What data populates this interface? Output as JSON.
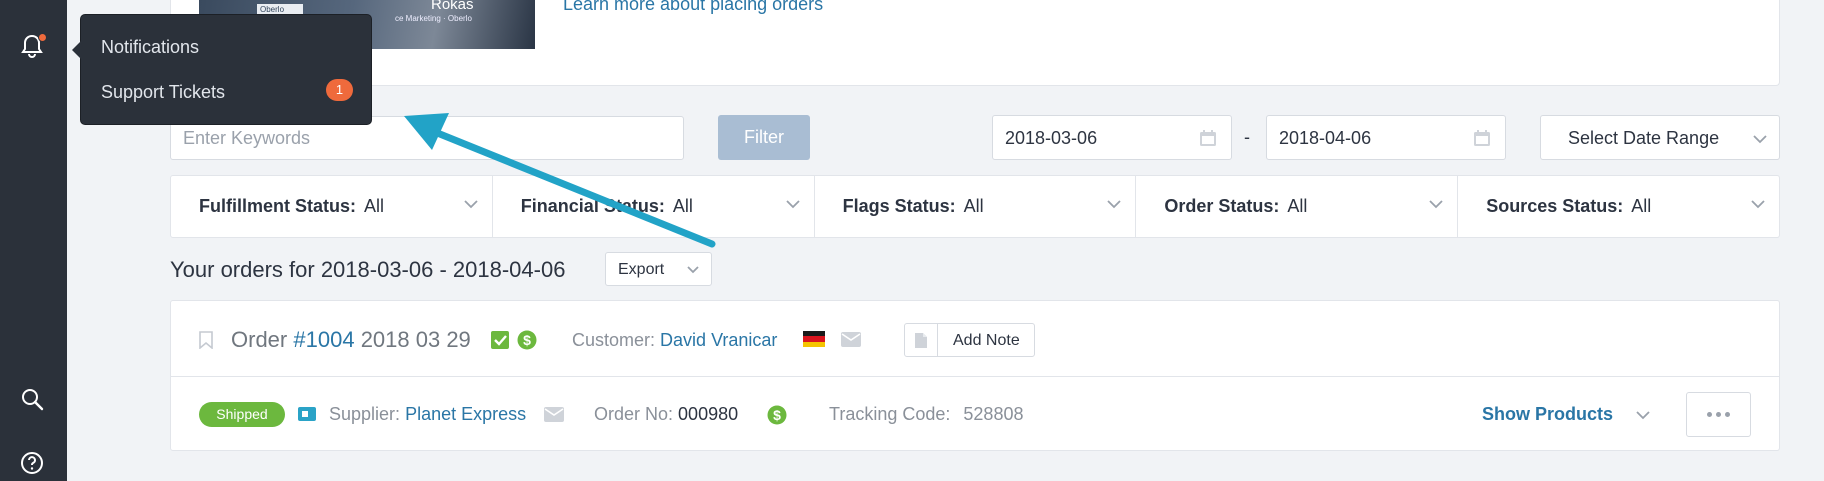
{
  "banner": {
    "image_title": "Rokas",
    "image_subtitle": "ce Marketing · Oberlo",
    "image_logo": "Oberlo",
    "link": "Learn more about placing orders"
  },
  "notifications_menu": {
    "items": [
      {
        "label": "Notifications"
      },
      {
        "label": "Support Tickets",
        "badge": "1"
      }
    ]
  },
  "filters": {
    "keyword_placeholder": "Enter Keywords",
    "filter_label": "Filter",
    "date_from": "2018-03-06",
    "date_separator": "-",
    "date_to": "2018-04-06",
    "date_range_label": "Select Date Range"
  },
  "statuses": [
    {
      "label": "Fulfillment Status:",
      "value": "All"
    },
    {
      "label": "Financial Status:",
      "value": "All"
    },
    {
      "label": "Flags Status:",
      "value": "All"
    },
    {
      "label": "Order Status:",
      "value": "All"
    },
    {
      "label": "Sources Status:",
      "value": "All"
    }
  ],
  "orders": {
    "heading": "Your orders for 2018-03-06 - 2018-04-06",
    "export_label": "Export",
    "items": [
      {
        "order_word": "Order",
        "number": "#1004",
        "date": "2018 03 29",
        "customer_label": "Customer:",
        "customer_name": "David Vranicar",
        "add_note_label": "Add Note",
        "status": "Shipped",
        "supplier_label": "Supplier:",
        "supplier_name": "Planet Express",
        "order_no_label": "Order No:",
        "order_no": "000980",
        "tracking_label": "Tracking Code:",
        "tracking_code": "528808",
        "show_products_label": "Show Products"
      }
    ]
  },
  "colors": {
    "sidebar": "#2b313a",
    "accent": "#2a76a6",
    "badge": "#ef6a3c",
    "shipped": "#6cb83e",
    "arrow": "#22a3c7"
  },
  "icons": [
    "bell-icon",
    "search-icon",
    "help-icon",
    "calendar-icon",
    "chevron-down-icon",
    "bookmark-icon",
    "check-icon",
    "dollar-icon",
    "mail-icon",
    "document-icon",
    "truck-icon",
    "more-icon",
    "flag-de-icon"
  ]
}
